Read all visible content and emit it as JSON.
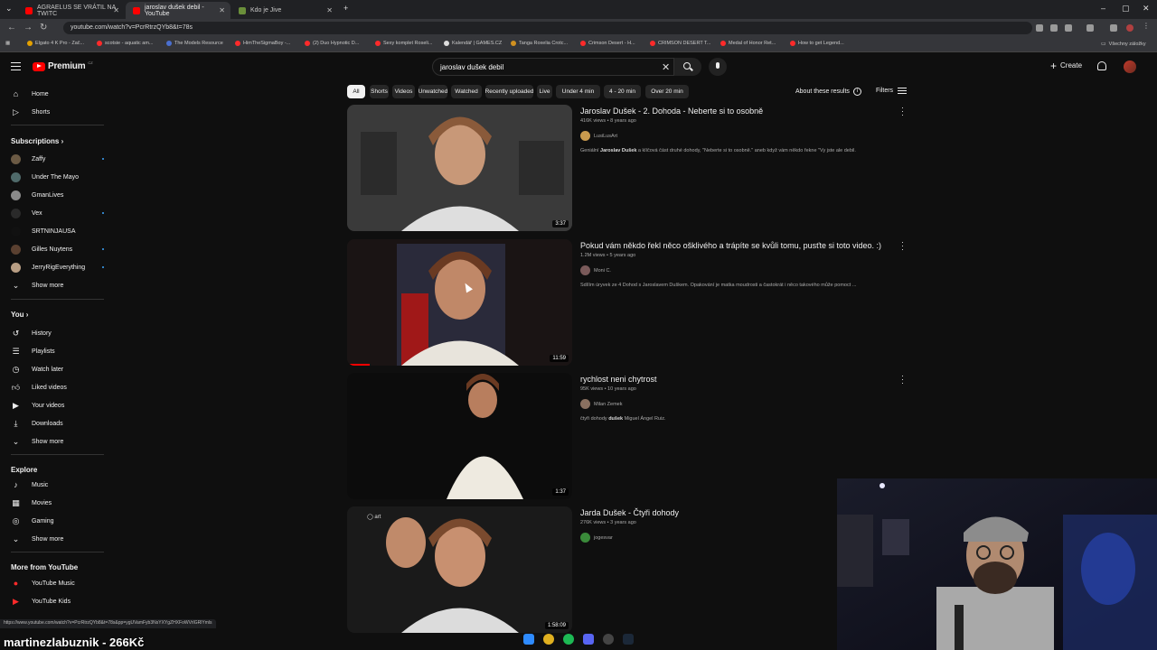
{
  "browser": {
    "tabs": [
      {
        "label": "AGRAELUS SE VRÁTIL NA TWITC"
      },
      {
        "label": "jaroslav dušek debil - YouTube"
      },
      {
        "label": "Kdo je Jive"
      }
    ],
    "url": "youtube.com/watch?v=PcrRtrzQYb8&t=78s",
    "bookmarks": [
      "Elgato 4 K Pro - Zač...",
      "scotsie - aquatic am...",
      "The Models Resource",
      "HimTheSigmaBoy -...",
      "(2) Duo Hypnotic D...",
      "Sexy komplet Roseli...",
      "Kalendář | GAMES.CZ",
      "Tanga Roxelia Crotc...",
      "Crimson Desert - H...",
      "CRIMSON DESERT T...",
      "Medal of Honor Ret...",
      "How to get Legend..."
    ],
    "all_bookmarks": "Všechny záložky"
  },
  "youtube": {
    "logo_text": "Premium",
    "logo_cc": "CZ",
    "search_value": "jaroslav dušek debil",
    "create_label": "Create"
  },
  "sidebar": {
    "main": [
      {
        "label": "Home",
        "icon": "home-icon"
      },
      {
        "label": "Shorts",
        "icon": "shorts-icon"
      }
    ],
    "subscriptions_heading": "Subscriptions",
    "subscriptions": [
      {
        "label": "Zaffy",
        "dot": true,
        "color": "#6b5a44"
      },
      {
        "label": "Under The Mayo",
        "dot": false,
        "color": "#4f6a6a"
      },
      {
        "label": "GmanLives",
        "dot": false,
        "color": "#8a8a8a"
      },
      {
        "label": "Vex",
        "dot": true,
        "color": "#2a2a2a"
      },
      {
        "label": "SRTNINJAUSA",
        "dot": false,
        "color": "#111111"
      },
      {
        "label": "Gilles Nuytens",
        "dot": true,
        "color": "#5a4030"
      },
      {
        "label": "JerryRigEverything",
        "dot": true,
        "color": "#b89e84"
      }
    ],
    "show_more_1": "Show more",
    "you_heading": "You",
    "you_items": [
      {
        "label": "History",
        "icon": "history-icon"
      },
      {
        "label": "Playlists",
        "icon": "playlists-icon"
      },
      {
        "label": "Watch later",
        "icon": "watch-later-icon"
      },
      {
        "label": "Liked videos",
        "icon": "like-icon"
      },
      {
        "label": "Your videos",
        "icon": "your-videos-icon"
      },
      {
        "label": "Downloads",
        "icon": "download-icon"
      }
    ],
    "show_more_2": "Show more",
    "explore_heading": "Explore",
    "explore_items": [
      {
        "label": "Music",
        "icon": "music-icon"
      },
      {
        "label": "Movies",
        "icon": "movies-icon"
      },
      {
        "label": "Gaming",
        "icon": "gaming-icon"
      }
    ],
    "show_more_3": "Show more",
    "more_heading": "More from YouTube",
    "more_items": [
      {
        "label": "YouTube Music",
        "icon": "youtube-music-icon"
      },
      {
        "label": "YouTube Kids",
        "icon": "youtube-kids-icon"
      }
    ]
  },
  "chips": [
    "All",
    "Shorts",
    "Videos",
    "Unwatched",
    "Watched",
    "Recently uploaded",
    "Live",
    "Under 4 min",
    "4 - 20 min",
    "Over 20 min"
  ],
  "about_label": "About these results",
  "filters_label": "Filters",
  "results": [
    {
      "title": "Jaroslav Dušek - 2. Dohoda - Neberte si to osobně",
      "meta": "416K views • 8 years ago",
      "channel": "LusiLusArt",
      "channel_color": "#c99a4e",
      "desc_prefix": "Geniální ",
      "desc_bold": "Jaroslav Dušek",
      "desc_suffix": " a klíčová část druhé dohody, \"Neberte si to osobně.\" aneb když vám někdo řekne \"Vy jste ale debil.",
      "duration": "3:37",
      "progress": 0
    },
    {
      "title": "Pokud vám někdo řekl něco ošklivého a trápíte se kvůli tomu, pusťte si toto video. :)",
      "meta": "1.2M views • 5 years ago",
      "channel": "Moni C.",
      "channel_color": "#7a5a5a",
      "desc_prefix": "Sdílím úryvek ze 4 Dohod s Jaroslavem Duškem. Opakování je matka moudrosti a častokrát i něco takového může pomoct ...",
      "desc_bold": "",
      "desc_suffix": "",
      "duration": "11:59",
      "progress": 0.1
    },
    {
      "title": "rychlost neni chytrost",
      "meta": "95K views • 10 years ago",
      "channel": "Milan Zemek",
      "channel_color": "#8a7060",
      "desc_prefix": "čtyři dohody ",
      "desc_bold": "dušek",
      "desc_suffix": " Miguel Ángel Ruiz.",
      "duration": "1:37",
      "progress": 0
    },
    {
      "title": "Jarda Dušek - Čtyři dohody",
      "meta": "276K views • 3 years ago",
      "channel": "jogesvar",
      "channel_color": "#3a8a3a",
      "desc_prefix": "",
      "desc_bold": "",
      "desc_suffix": "",
      "duration": "1:58:09",
      "progress": 0
    }
  ],
  "status_url": "https://www.youtube.com/watch?v=PcrRtrzQYb8&t=78s&pp=ygUVamFyb3NsYXYgZHXFoWVrIGRlYmls",
  "stream_overlay": "martinezlabuznik - 266Kč",
  "colors": {
    "accent": "#ff0000",
    "background": "#0f0f0f",
    "chip": "#272727"
  }
}
